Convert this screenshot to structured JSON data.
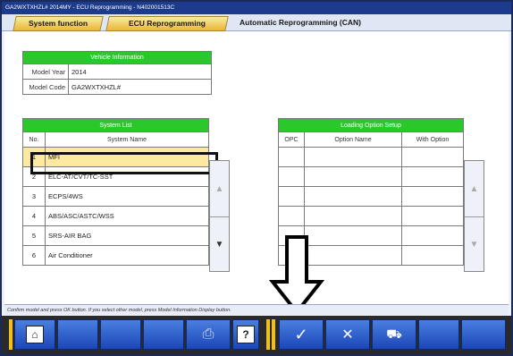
{
  "window": {
    "title": "GA2WXTXHZL# 2014MY  -  ECU Reprogramming  -  N402001513C"
  },
  "tabs": [
    {
      "label": "System function"
    },
    {
      "label": "ECU Reprogramming"
    },
    {
      "label": "Automatic Reprogramming (CAN)"
    }
  ],
  "vehicle_info": {
    "header": "Vehicle Information",
    "rows": [
      {
        "label": "Model Year",
        "value": "2014"
      },
      {
        "label": "Model Code",
        "value": "GA2WXTXHZL#"
      }
    ]
  },
  "system_list": {
    "header": "System List",
    "col_no": "No.",
    "col_name": "System Name",
    "rows": [
      {
        "no": "1",
        "name": "MFI"
      },
      {
        "no": "2",
        "name": "ELC-AT/CVT/TC-SST"
      },
      {
        "no": "3",
        "name": "ECPS/4WS"
      },
      {
        "no": "4",
        "name": "ABS/ASC/ASTC/WSS"
      },
      {
        "no": "5",
        "name": "SRS-AIR BAG"
      },
      {
        "no": "6",
        "name": "Air Conditioner"
      }
    ],
    "selected_index": 0
  },
  "loading_option": {
    "header": "Loading Option Setup",
    "col_opc": "OPC",
    "col_name": "Option Name",
    "col_with": "With Option"
  },
  "status_text": "Confirm model and press OK button. If you select other model, press Model Information Display button.",
  "toolbar": {
    "home_icon": "home-icon",
    "print_icon": "printer-icon",
    "help_label": "?",
    "ok_icon": "check-icon",
    "cancel_icon": "cross-icon",
    "vehicle_icon": "car-icon"
  },
  "colors": {
    "accent_green": "#2bc82b",
    "tab_gold": "#e9b732",
    "toolbar_blue": "#1b46b8",
    "selection": "#fde9a0"
  }
}
